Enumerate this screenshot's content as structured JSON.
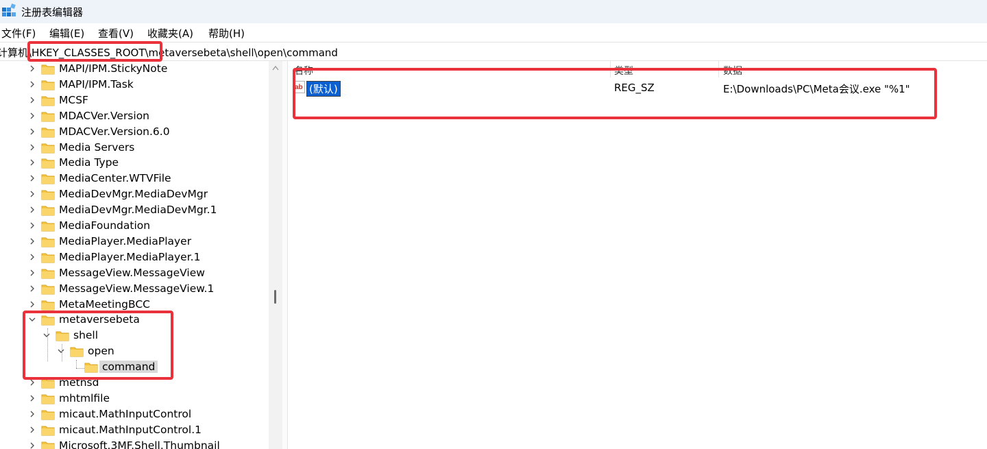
{
  "window": {
    "title": "注册表编辑器"
  },
  "menu": [
    "文件(F)",
    "编辑(E)",
    "查看(V)",
    "收藏夹(A)",
    "帮助(H)"
  ],
  "address": {
    "path": "计算机\\HKEY_CLASSES_ROOT\\metaversebeta\\shell\\open\\command"
  },
  "tree": {
    "nodes": [
      {
        "label": "MAPI/IPM.StickyNote",
        "expanded": false
      },
      {
        "label": "MAPI/IPM.Task",
        "expanded": false
      },
      {
        "label": "MCSF",
        "expanded": false
      },
      {
        "label": "MDACVer.Version",
        "expanded": false
      },
      {
        "label": "MDACVer.Version.6.0",
        "expanded": false
      },
      {
        "label": "Media Servers",
        "expanded": false
      },
      {
        "label": "Media Type",
        "expanded": false
      },
      {
        "label": "MediaCenter.WTVFile",
        "expanded": false
      },
      {
        "label": "MediaDevMgr.MediaDevMgr",
        "expanded": false
      },
      {
        "label": "MediaDevMgr.MediaDevMgr.1",
        "expanded": false
      },
      {
        "label": "MediaFoundation",
        "expanded": false
      },
      {
        "label": "MediaPlayer.MediaPlayer",
        "expanded": false
      },
      {
        "label": "MediaPlayer.MediaPlayer.1",
        "expanded": false
      },
      {
        "label": "MessageView.MessageView",
        "expanded": false
      },
      {
        "label": "MessageView.MessageView.1",
        "expanded": false
      },
      {
        "label": "MetaMeetingBCC",
        "expanded": false
      },
      {
        "label": "metaversebeta",
        "expanded": true
      },
      {
        "label": "shell",
        "expanded": true
      },
      {
        "label": "open",
        "expanded": true
      },
      {
        "label": "command",
        "selected": true
      },
      {
        "label": "metnsd",
        "expanded": false
      },
      {
        "label": "mhtmlfile",
        "expanded": false
      },
      {
        "label": "micaut.MathInputControl",
        "expanded": false
      },
      {
        "label": "micaut.MathInputControl.1",
        "expanded": false
      },
      {
        "label": "Microsoft.3MF.Shell.Thumbnail",
        "expanded": false
      }
    ]
  },
  "values": {
    "headers": {
      "name": "名称",
      "type": "类型",
      "data": "数据"
    },
    "rows": [
      {
        "name": "(默认)",
        "type": "REG_SZ",
        "data": "E:\\Downloads\\PC\\Meta会议.exe \"%1\"",
        "icon": "string-value-icon"
      }
    ]
  },
  "colors": {
    "highlight": "#e9323b",
    "selection": "#0b5fd0",
    "folder": "#f6c643",
    "titlebar": "#eef3fa"
  }
}
